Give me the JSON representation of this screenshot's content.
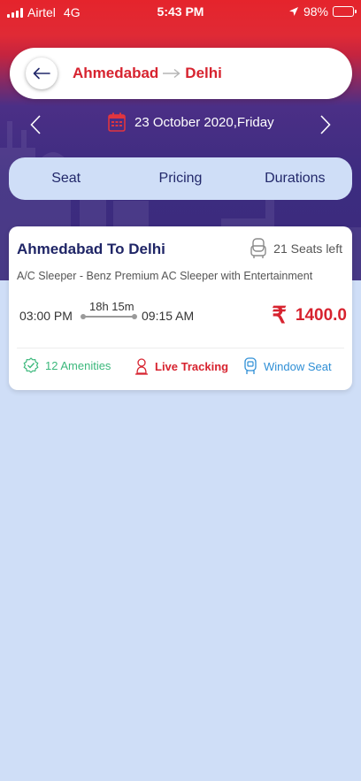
{
  "status_bar": {
    "carrier": "Airtel",
    "network": "4G",
    "time": "5:43 PM",
    "battery": "98%"
  },
  "search": {
    "from": "Ahmedabad",
    "to": "Delhi",
    "date": "23 October 2020,Friday"
  },
  "sort_tabs": [
    "Seat",
    "Pricing",
    "Durations"
  ],
  "buses": [
    {
      "title": "Ahmedabad To Delhi",
      "seats_left": "21 Seats left",
      "bus_type": "A/C Sleeper - Benz Premium AC Sleeper with Entertainment",
      "departure": "03:00 PM",
      "duration": "18h 15m",
      "arrival": "09:15 AM",
      "currency_symbol": "₹",
      "price": "1400.0",
      "features": {
        "amenities": "12 Amenities",
        "tracking": "Live Tracking",
        "window": "Window Seat"
      }
    }
  ],
  "colors": {
    "brand_red": "#d7232f",
    "header_purple": "#3d2c80",
    "page_bg": "#cfdef7",
    "amenity_green": "#3cb87c",
    "window_blue": "#2f8fd6",
    "text_navy": "#1f2566"
  },
  "icons": {
    "back": "arrow-left-icon",
    "calendar": "calendar-icon",
    "prev_date": "chevron-left-icon",
    "next_date": "chevron-right-icon",
    "seat": "seat-icon",
    "amenities": "check-badge-icon",
    "tracking": "person-location-icon",
    "window": "window-seat-icon"
  }
}
